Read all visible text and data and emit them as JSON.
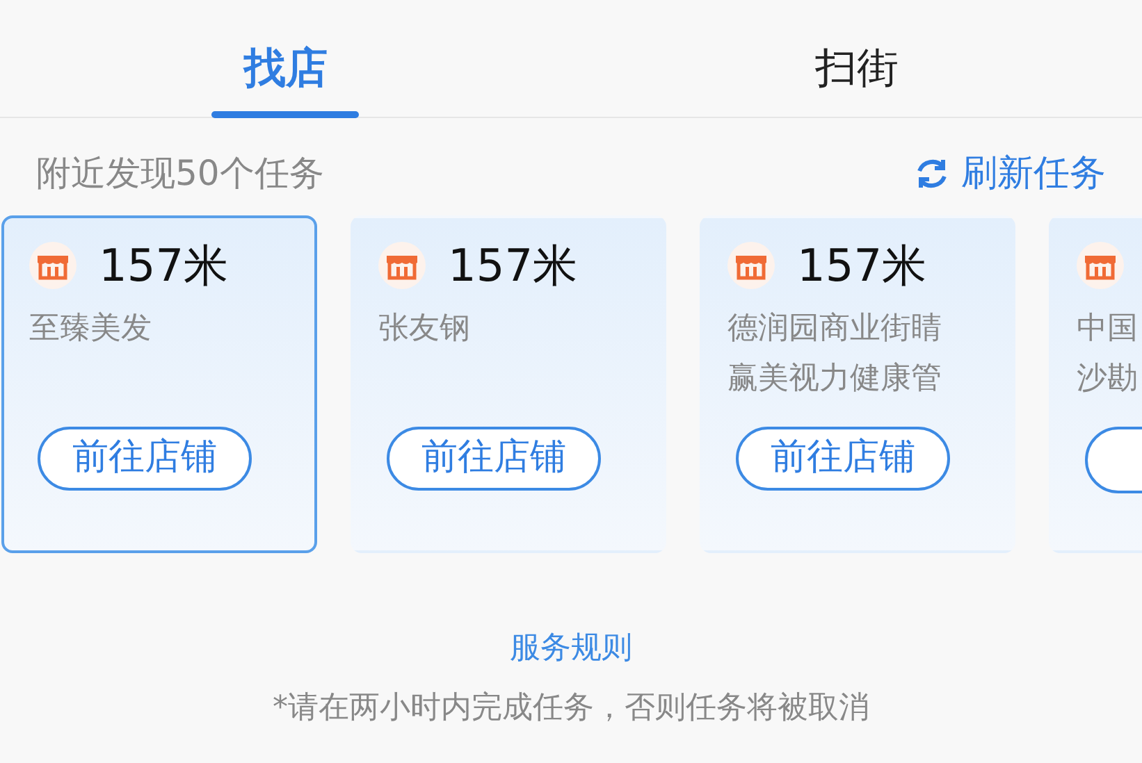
{
  "tabs": [
    {
      "label": "找店",
      "selected": true
    },
    {
      "label": "扫街",
      "selected": false
    }
  ],
  "summary": "附近发现50个任务",
  "refresh_link": "刷新任务",
  "stores": [
    {
      "distance": "157米",
      "name_lines": [
        "至臻美发"
      ],
      "button": "前往店铺",
      "selected": true
    },
    {
      "distance": "157米",
      "name_lines": [
        "张友钢"
      ],
      "button": "前往店铺",
      "selected": false
    },
    {
      "distance": "157米",
      "name_lines": [
        "德润园商业街睛",
        "赢美视力健康管"
      ],
      "button": "前往店铺",
      "selected": false
    },
    {
      "name_lines": [
        "中国",
        "沙勘"
      ],
      "selected": false
    }
  ],
  "rules_link": "服务规则",
  "note": "*请在两小时内完成任务，否则任务将被取消"
}
